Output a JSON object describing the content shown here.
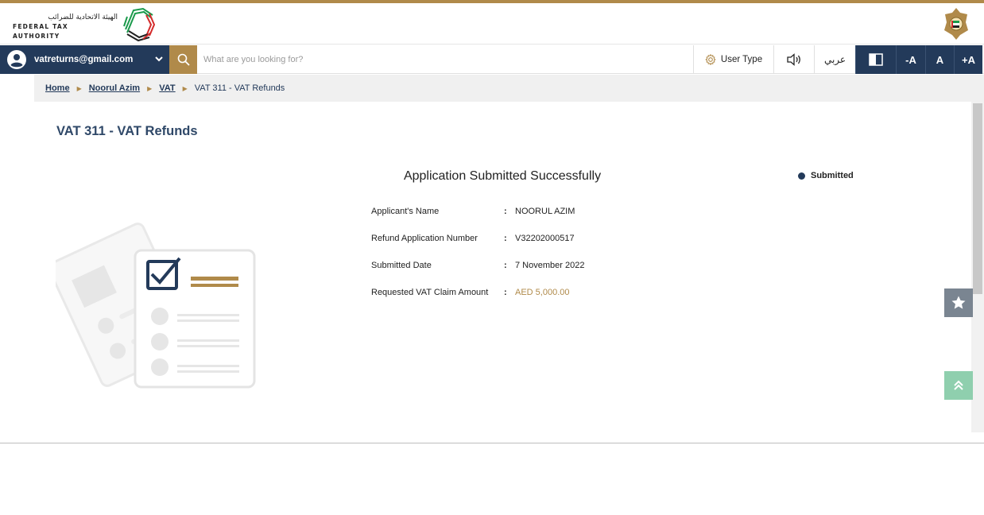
{
  "header": {
    "logo_ar": "الهيئة الاتحادية للضرائب",
    "logo_en": "FEDERAL TAX AUTHORITY",
    "brand_color": "#b08a4a",
    "primary_color": "#233a5a"
  },
  "navbar": {
    "user_email": "vatreturns@gmail.com",
    "search_placeholder": "What are you looking for?",
    "user_type_label": "User Type",
    "arabic_label": "عربي",
    "font_decrease": "-A",
    "font_normal": "A",
    "font_increase": "+A"
  },
  "breadcrumb": {
    "items": [
      "Home",
      "Noorul Azim",
      "VAT"
    ],
    "current": "VAT 311 - VAT Refunds"
  },
  "page": {
    "title": "VAT 311 - VAT Refunds",
    "success_title": "Application Submitted Successfully",
    "status": "Submitted"
  },
  "details": [
    {
      "label": "Applicant's Name",
      "value": "NOORUL AZIM"
    },
    {
      "label": "Refund Application Number",
      "value": "V32202000517"
    },
    {
      "label": "Submitted Date",
      "value": "7 November 2022"
    },
    {
      "label": "Requested VAT Claim Amount",
      "value": "AED 5,000.00"
    }
  ]
}
